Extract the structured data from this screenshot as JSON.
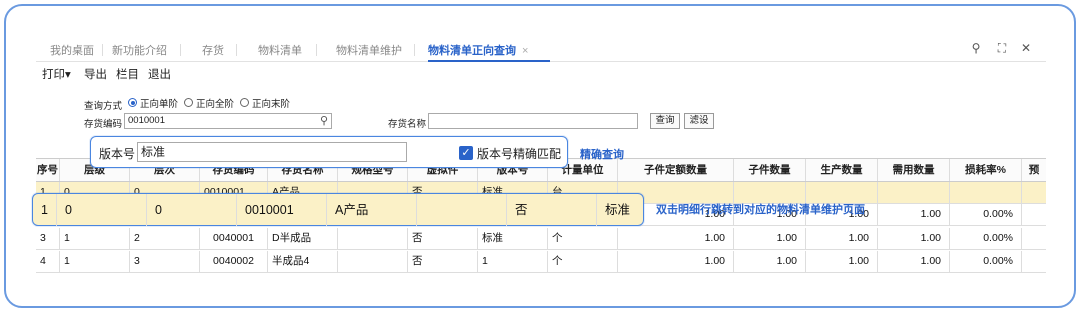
{
  "tabs": [
    {
      "label": "我的桌面"
    },
    {
      "label": "新功能介绍"
    },
    {
      "label": "存货"
    },
    {
      "label": "物料清单"
    },
    {
      "label": "物料清单维护"
    },
    {
      "label": "物料清单正向查询",
      "close": "×"
    }
  ],
  "window_icons": {
    "search": "⚲",
    "expand": "⛶",
    "close": "✕"
  },
  "toolbar": {
    "print": "打印",
    "print_arrow": "▾",
    "export": "导出",
    "columns": "栏目",
    "exit": "退出"
  },
  "query": {
    "mode_label": "查询方式",
    "modes": [
      "正向单阶",
      "正向全阶",
      "正向末阶"
    ],
    "item_code_label": "存货编码",
    "item_code_value": "0010001",
    "item_name_label": "存货名称",
    "item_name_value": "",
    "query_button": "查询",
    "filter_button": "滤设"
  },
  "version_popup": {
    "label": "版本号",
    "value": "标准",
    "checkbox_label": "版本号精确匹配",
    "checked": true,
    "callout": "精确查询"
  },
  "grid": {
    "headers": [
      "序号",
      "层级",
      "层次",
      "存货编码",
      "存货名称",
      "规格型号",
      "虚拟件",
      "版本号",
      "计量单位",
      "子件定额数量",
      "子件数量",
      "生产数量",
      "需用数量",
      "损耗率%",
      "预"
    ],
    "row1_partial": [
      "1",
      "0",
      "0",
      "0010001",
      "A产品",
      "",
      "否",
      "标准",
      "台"
    ],
    "rows": [
      {
        "seq": "3",
        "level": "1",
        "layer": "2",
        "code": "0040001",
        "name": "D半成品",
        "spec": "",
        "virtual": "否",
        "version": "标准",
        "unit": "个",
        "qty_def": "1.00",
        "qty": "1.00",
        "prod": "1.00",
        "need": "1.00",
        "loss": "0.00%"
      },
      {
        "seq": "4",
        "level": "1",
        "layer": "3",
        "code": "0040002",
        "name": "半成品4",
        "spec": "",
        "virtual": "否",
        "version": "1",
        "unit": "个",
        "qty_def": "1.00",
        "qty": "1.00",
        "prod": "1.00",
        "need": "1.00",
        "loss": "0.00%"
      }
    ],
    "row2_nums": {
      "qty_def": "1.00",
      "qty": "1.00",
      "prod": "1.00",
      "need": "1.00",
      "loss": "0.00%"
    }
  },
  "row_zoom": {
    "seq": "1",
    "level": "0",
    "layer": "0",
    "code": "0010001",
    "name": "A产品",
    "virtual": "否",
    "version": "标准",
    "callout": "双击明细行跳转到对应的物料清单维护页面"
  }
}
